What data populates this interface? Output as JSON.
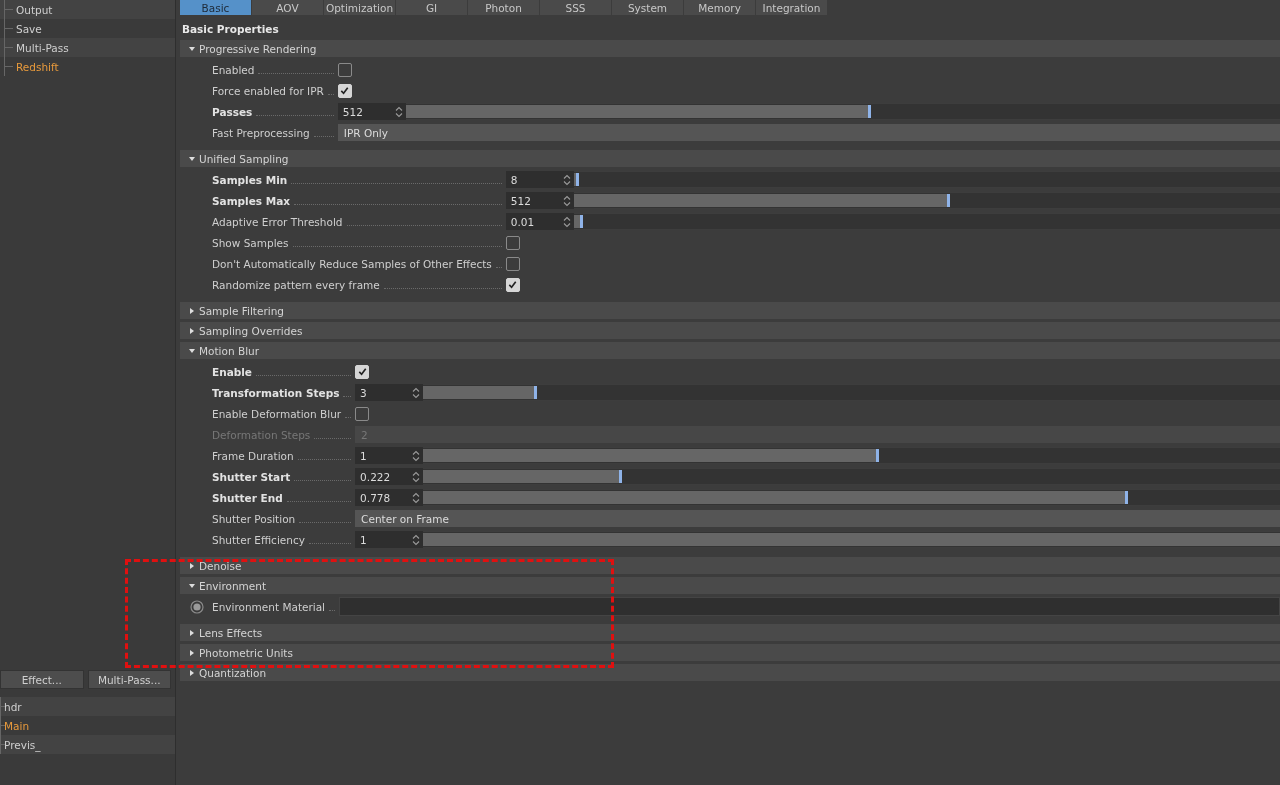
{
  "sidebar": {
    "items": [
      {
        "label": "Output",
        "selected": false
      },
      {
        "label": "Save",
        "selected": false
      },
      {
        "label": "Multi-Pass",
        "selected": false
      },
      {
        "label": "Redshift",
        "selected": true
      }
    ],
    "buttons": [
      "Effect...",
      "Multi-Pass..."
    ],
    "presets": [
      {
        "label": "hdr",
        "selected": false
      },
      {
        "label": "Main",
        "selected": true
      },
      {
        "label": "Previs_",
        "selected": false
      }
    ]
  },
  "tabs": [
    {
      "label": "Basic",
      "selected": true
    },
    {
      "label": "AOV",
      "selected": false
    },
    {
      "label": "Optimization",
      "selected": false
    },
    {
      "label": "GI",
      "selected": false
    },
    {
      "label": "Photon",
      "selected": false
    },
    {
      "label": "SSS",
      "selected": false
    },
    {
      "label": "System",
      "selected": false
    },
    {
      "label": "Memory",
      "selected": false
    },
    {
      "label": "Integration",
      "selected": false
    }
  ],
  "heading": "Basic Properties",
  "sections": [
    {
      "title": "Progressive Rendering",
      "expanded": true,
      "rows": [
        {
          "kind": "checkbox",
          "label": "Enabled",
          "bold": false,
          "disabled": false,
          "checked": false
        },
        {
          "kind": "checkbox",
          "label": "Force enabled for IPR",
          "bold": false,
          "disabled": false,
          "checked": true
        },
        {
          "kind": "slider",
          "label": "Passes",
          "bold": true,
          "disabled": false,
          "value": "512",
          "level": 0.53
        },
        {
          "kind": "dropdown",
          "label": "Fast Preprocessing",
          "bold": false,
          "disabled": false,
          "value": "IPR Only"
        }
      ]
    },
    {
      "title": "Unified Sampling",
      "expanded": true,
      "rows": [
        {
          "kind": "slider",
          "label": "Samples Min",
          "bold": true,
          "disabled": false,
          "value": "8",
          "level": 0.005
        },
        {
          "kind": "slider",
          "label": "Samples Max",
          "bold": true,
          "disabled": false,
          "value": "512",
          "level": 0.53
        },
        {
          "kind": "slider",
          "label": "Adaptive Error Threshold",
          "bold": false,
          "disabled": false,
          "value": "0.01",
          "level": 0.01
        },
        {
          "kind": "checkbox",
          "label": "Show Samples",
          "bold": false,
          "disabled": false,
          "checked": false
        },
        {
          "kind": "checkbox",
          "label": "Don't Automatically Reduce Samples of Other Effects",
          "bold": false,
          "disabled": false,
          "checked": false
        },
        {
          "kind": "checkbox",
          "label": "Randomize pattern every frame",
          "bold": false,
          "disabled": false,
          "checked": true
        }
      ]
    },
    {
      "title": "Sample Filtering",
      "expanded": false
    },
    {
      "title": "Sampling Overrides",
      "expanded": false
    },
    {
      "title": "Motion Blur",
      "expanded": true,
      "rows": [
        {
          "kind": "checkbox",
          "label": "Enable",
          "bold": true,
          "disabled": false,
          "checked": true
        },
        {
          "kind": "slider",
          "label": "Transformation Steps",
          "bold": true,
          "disabled": false,
          "value": "3",
          "level": 0.13
        },
        {
          "kind": "checkbox",
          "label": "Enable Deformation Blur",
          "bold": false,
          "disabled": false,
          "checked": false
        },
        {
          "kind": "number",
          "label": "Deformation Steps",
          "bold": false,
          "disabled": true,
          "value": "2"
        },
        {
          "kind": "slider",
          "label": "Frame Duration",
          "bold": false,
          "disabled": false,
          "value": "1",
          "level": 0.53
        },
        {
          "kind": "slider",
          "label": "Shutter Start",
          "bold": true,
          "disabled": false,
          "value": "0.222",
          "level": 0.23
        },
        {
          "kind": "slider",
          "label": "Shutter End",
          "bold": true,
          "disabled": false,
          "value": "0.778",
          "level": 0.82
        },
        {
          "kind": "dropdown",
          "label": "Shutter Position",
          "bold": false,
          "disabled": false,
          "value": "Center on Frame"
        },
        {
          "kind": "slider",
          "label": "Shutter Efficiency",
          "bold": false,
          "disabled": false,
          "value": "1",
          "level": 1
        }
      ]
    },
    {
      "title": "Denoise",
      "expanded": false
    },
    {
      "title": "Environment",
      "expanded": true,
      "rows": [
        {
          "kind": "link",
          "label": "Environment Material",
          "bold": false,
          "disabled": false
        }
      ]
    },
    {
      "title": "Lens Effects",
      "expanded": false
    },
    {
      "title": "Photometric Units",
      "expanded": false
    },
    {
      "title": "Quantization",
      "expanded": false
    }
  ]
}
